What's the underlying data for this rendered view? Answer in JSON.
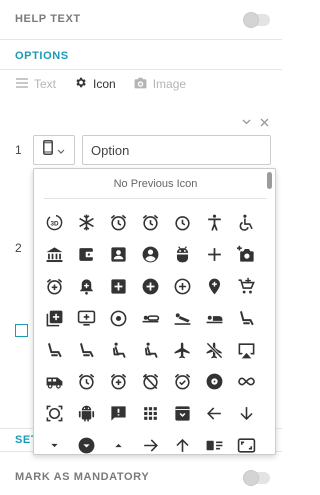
{
  "help_text": {
    "label": "HELP TEXT",
    "enabled": false
  },
  "options_section": {
    "label": "OPTIONS"
  },
  "tabs": [
    {
      "label": "Text",
      "icon": "lines-icon",
      "active": false
    },
    {
      "label": "Icon",
      "icon": "gear-icon",
      "active": true
    },
    {
      "label": "Image",
      "icon": "camera-icon",
      "active": false
    }
  ],
  "option_rows": [
    {
      "number": "1",
      "value": "Option",
      "icon": "mobile-icon"
    },
    {
      "number": "2"
    }
  ],
  "icon_picker": {
    "header": "No Previous Icon",
    "icons": [
      "3d-rotation",
      "ac-unit",
      "access-alarm",
      "access-alarms",
      "access-time",
      "accessibility",
      "accessible",
      "account-balance",
      "account-balance-wallet",
      "account-box",
      "account-circle",
      "adb",
      "add",
      "add-a-photo",
      "add-alarm",
      "add-alert",
      "add-box",
      "add-circle",
      "add-circle-outline",
      "add-location",
      "add-shopping-cart",
      "add-to-photos",
      "add-to-queue",
      "adjust",
      "airline-seat-flat",
      "airline-seat-flat-angled",
      "airline-seat-individual-suite",
      "airline-seat-legroom-extra",
      "airline-seat-legroom-normal",
      "airline-seat-legroom-reduced",
      "airline-seat-recline-extra",
      "airline-seat-recline-normal",
      "airplanemode-active",
      "airplanemode-inactive",
      "airplay",
      "airport-shuttle",
      "alarm",
      "alarm-add",
      "alarm-off",
      "alarm-on",
      "album",
      "all-inclusive",
      "all-out",
      "android",
      "announcement",
      "apps",
      "archive",
      "arrow-back",
      "arrow-downward",
      "arrow-drop-down",
      "arrow-drop-down-circle",
      "arrow-drop-up",
      "arrow-forward",
      "arrow-upward",
      "art-track",
      "aspect-ratio"
    ]
  },
  "settings_section": {
    "label": "SET"
  },
  "mandatory": {
    "label": "MARK AS MANDATORY",
    "enabled": false
  },
  "colors": {
    "accent": "#1a9bb5",
    "text": "#555555",
    "border": "#cccccc"
  }
}
